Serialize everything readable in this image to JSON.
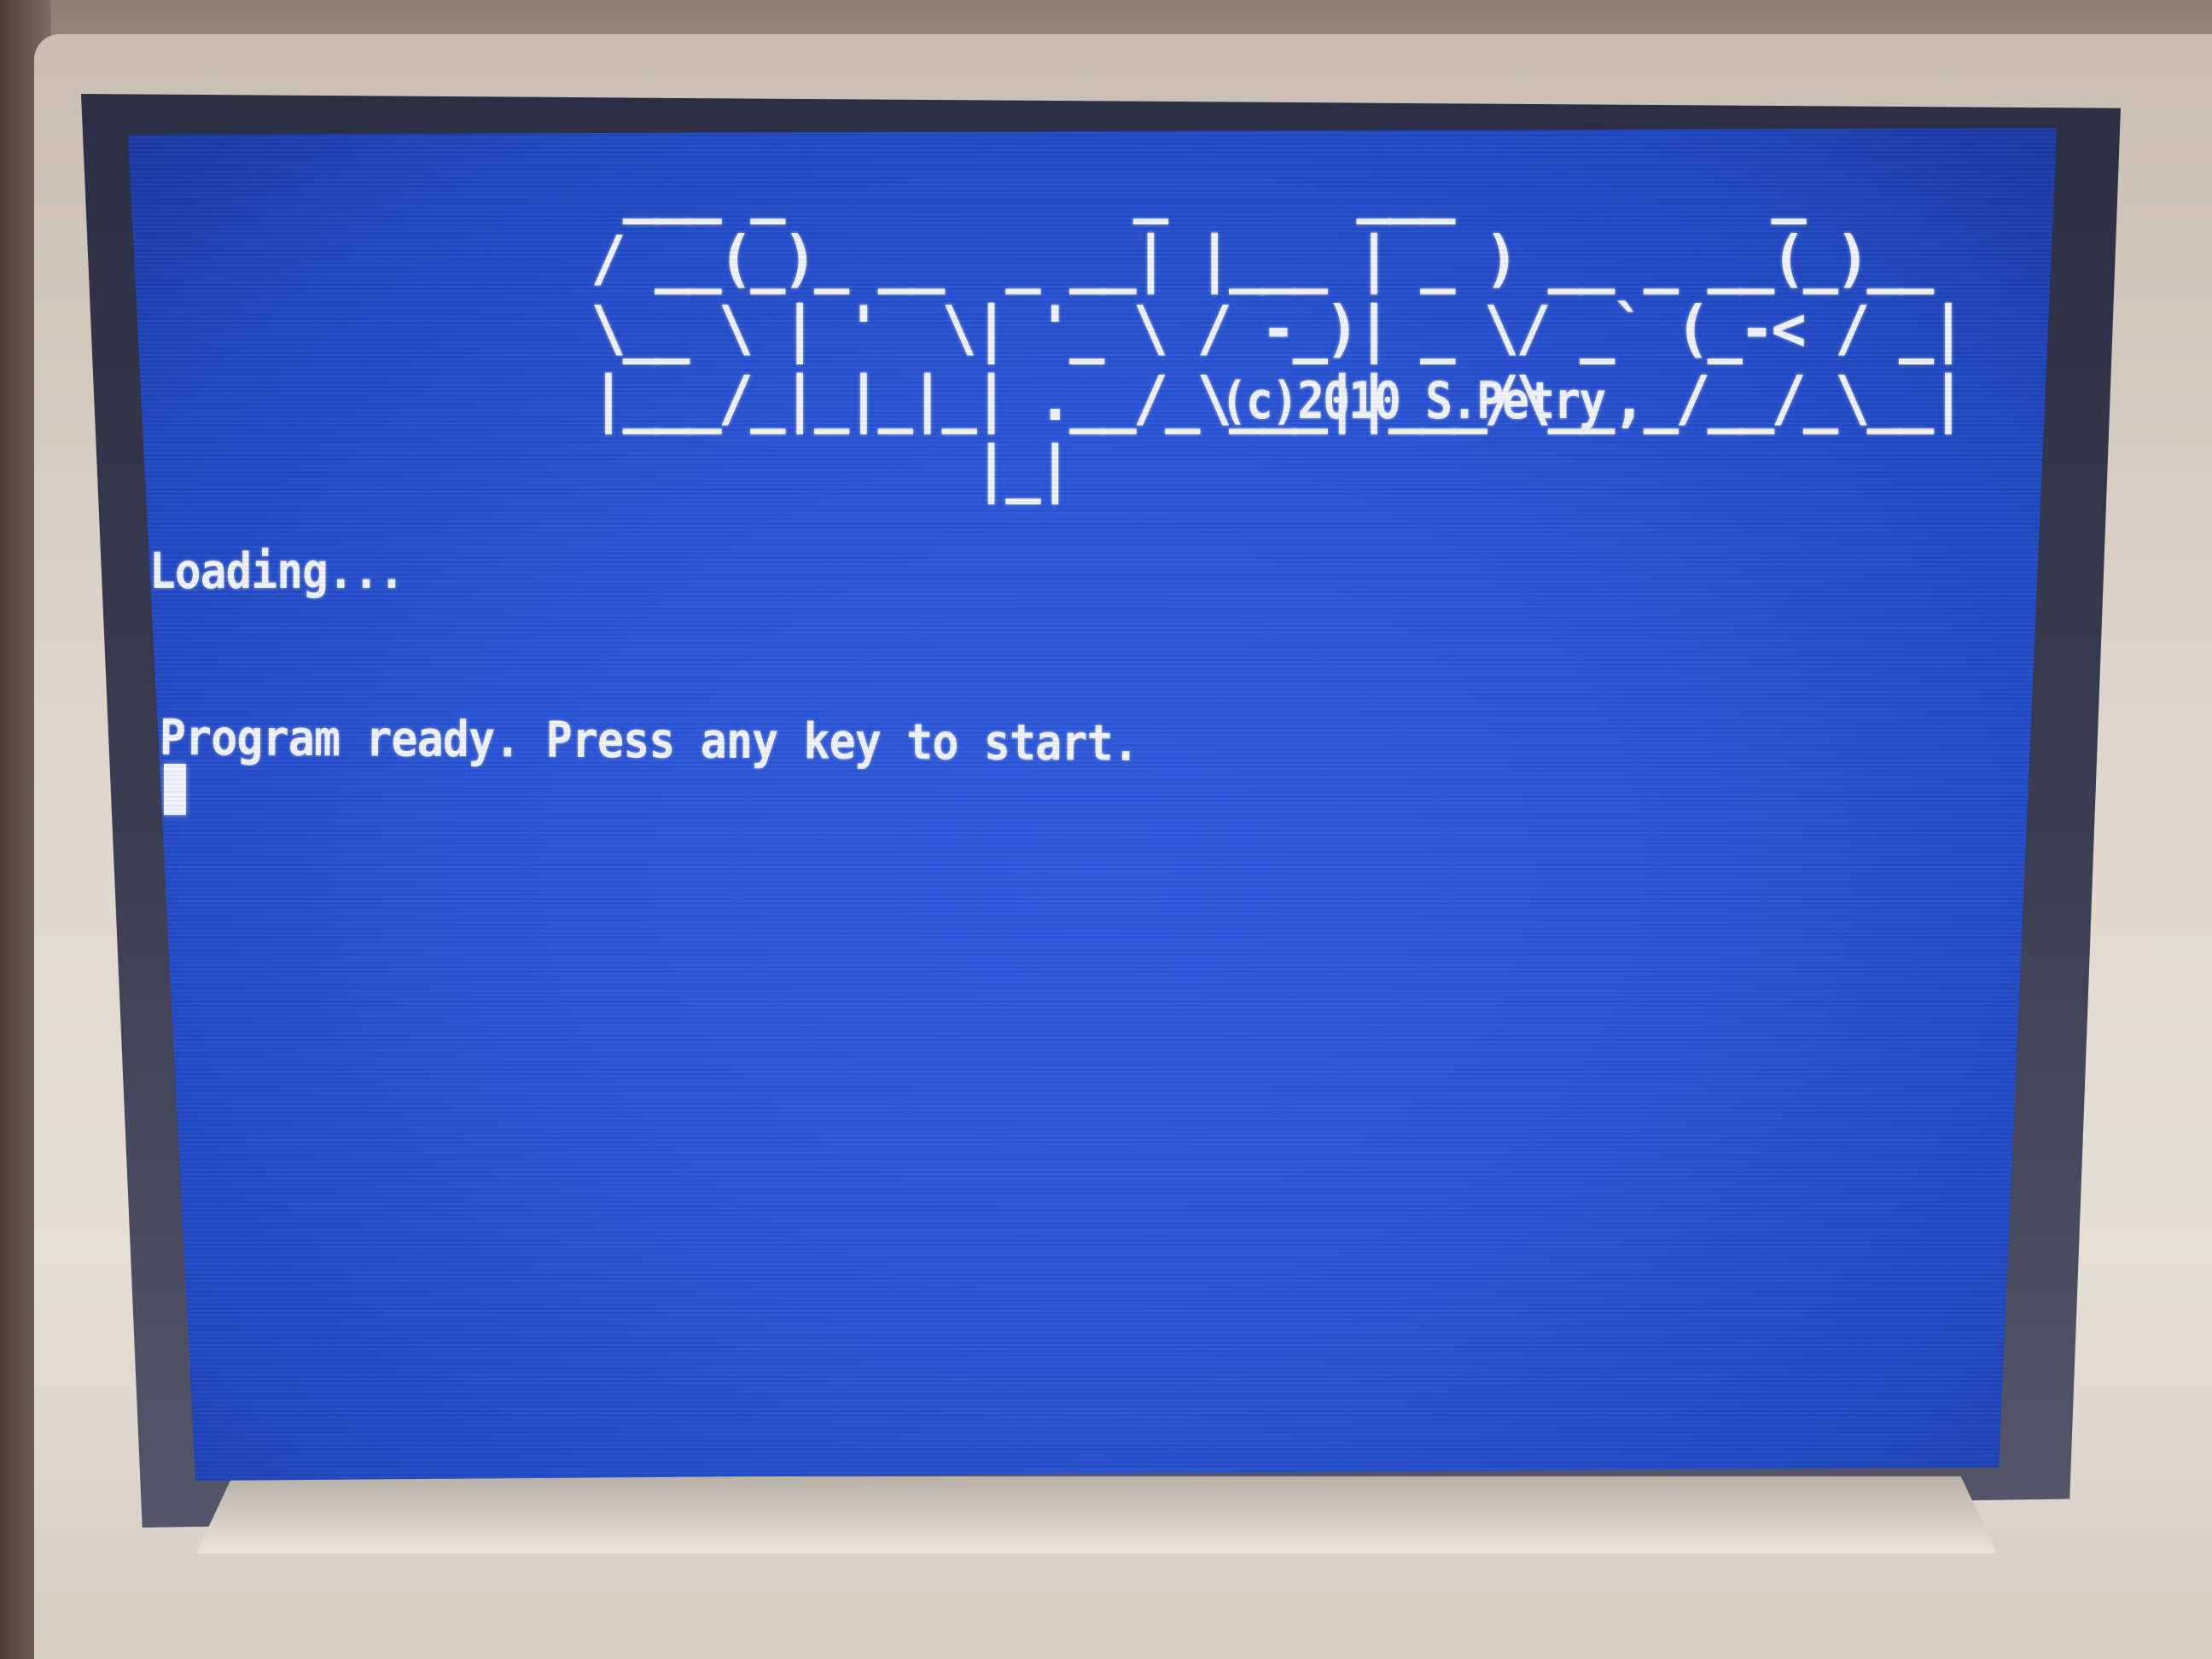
{
  "screen": {
    "logo_art": "  ___ _           _      ___          _     \n / __(_)_ __  _ __| |___ | _ ) __ _ __(_)__  \n \\__ \\ | '  \\| '_ \\ / -_)| _ \\/ _` (_-< / _| \n |___/_|_|_|_| .__/_\\___||___/\\__,_/__/_\\__| \n             |_|",
    "copyright": "(c)2010 S.Petry",
    "loading_text": "Loading...",
    "ready_text": "Program ready. Press any key to start."
  },
  "colors": {
    "screen_background": "#2a55d8",
    "text": "#f4f6ff",
    "bezel": "#ddd5ca"
  }
}
